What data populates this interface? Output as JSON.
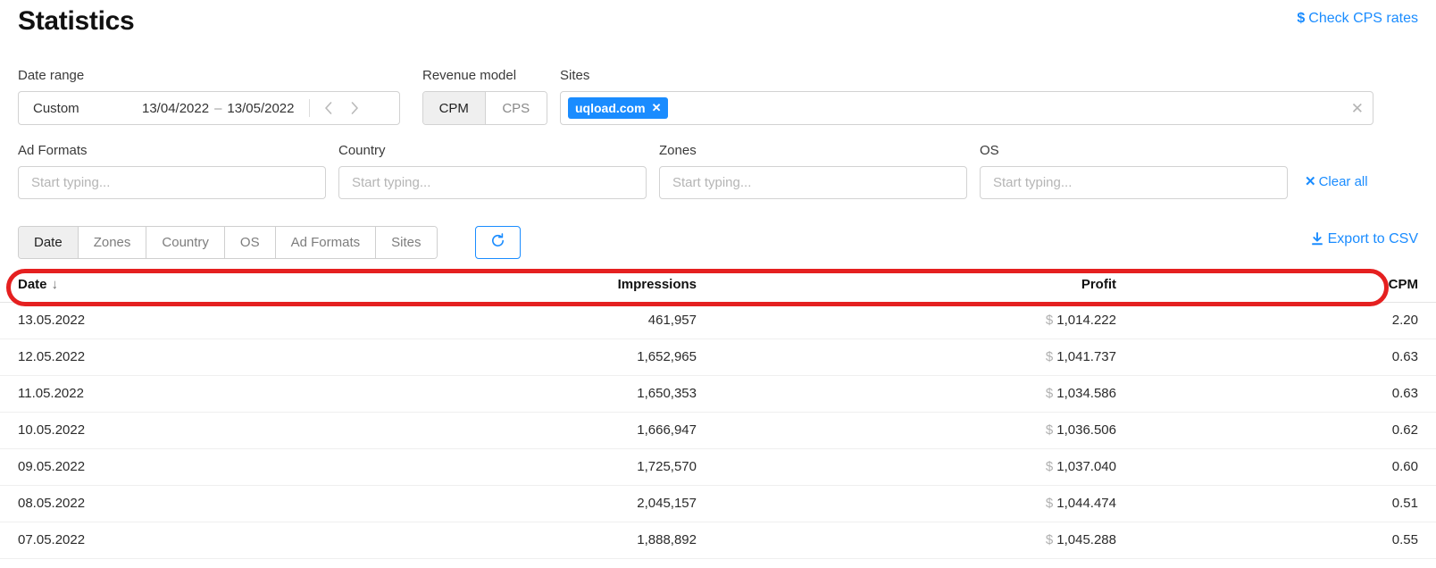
{
  "header": {
    "title": "Statistics",
    "cps_link": "Check CPS rates",
    "cps_icon": "$"
  },
  "filters": {
    "date_range": {
      "label": "Date range",
      "preset": "Custom",
      "start": "13/04/2022",
      "dash": "–",
      "end": "13/05/2022",
      "prev_icon": "chevron-left",
      "next_icon": "chevron-right"
    },
    "revenue_model": {
      "label": "Revenue model",
      "options": [
        "CPM",
        "CPS"
      ],
      "selected": "CPM"
    },
    "sites": {
      "label": "Sites",
      "chips": [
        {
          "label": "uqload.com",
          "remove": "✕"
        }
      ],
      "clear_icon": "✕"
    },
    "ad_formats": {
      "label": "Ad Formats",
      "placeholder": "Start typing...",
      "value": ""
    },
    "country": {
      "label": "Country",
      "placeholder": "Start typing...",
      "value": ""
    },
    "zones": {
      "label": "Zones",
      "placeholder": "Start typing...",
      "value": ""
    },
    "os": {
      "label": "OS",
      "placeholder": "Start typing...",
      "value": ""
    },
    "clear_all": {
      "label": "Clear all",
      "icon": "✕"
    }
  },
  "toolbar": {
    "tabs": [
      {
        "label": "Date",
        "active": true
      },
      {
        "label": "Zones",
        "active": false
      },
      {
        "label": "Country",
        "active": false
      },
      {
        "label": "OS",
        "active": false
      },
      {
        "label": "Ad Formats",
        "active": false
      },
      {
        "label": "Sites",
        "active": false
      }
    ],
    "refresh_icon": "refresh",
    "export_label": "Export to CSV",
    "export_icon": "download"
  },
  "table": {
    "columns": [
      "Date",
      "Impressions",
      "Profit",
      "CPM"
    ],
    "sort": {
      "column": "Date",
      "direction": "desc",
      "glyph": "↓"
    },
    "currency_symbol": "$",
    "rows": [
      {
        "date": "13.05.2022",
        "impressions": "461,957",
        "profit": "1,014.222",
        "cpm": "2.20"
      },
      {
        "date": "12.05.2022",
        "impressions": "1,652,965",
        "profit": "1,041.737",
        "cpm": "0.63"
      },
      {
        "date": "11.05.2022",
        "impressions": "1,650,353",
        "profit": "1,034.586",
        "cpm": "0.63"
      },
      {
        "date": "10.05.2022",
        "impressions": "1,666,947",
        "profit": "1,036.506",
        "cpm": "0.62"
      },
      {
        "date": "09.05.2022",
        "impressions": "1,725,570",
        "profit": "1,037.040",
        "cpm": "0.60"
      },
      {
        "date": "08.05.2022",
        "impressions": "2,045,157",
        "profit": "1,044.474",
        "cpm": "0.51"
      },
      {
        "date": "07.05.2022",
        "impressions": "1,888,892",
        "profit": "1,045.288",
        "cpm": "0.55"
      }
    ]
  },
  "annotation": {
    "shape": "oval",
    "color": "#e52020",
    "target": "table-header-row"
  },
  "colors": {
    "accent": "#1a8cff",
    "annotation": "#e52020",
    "chip": "#1a8cff",
    "active_tab_bg": "#efefef"
  }
}
